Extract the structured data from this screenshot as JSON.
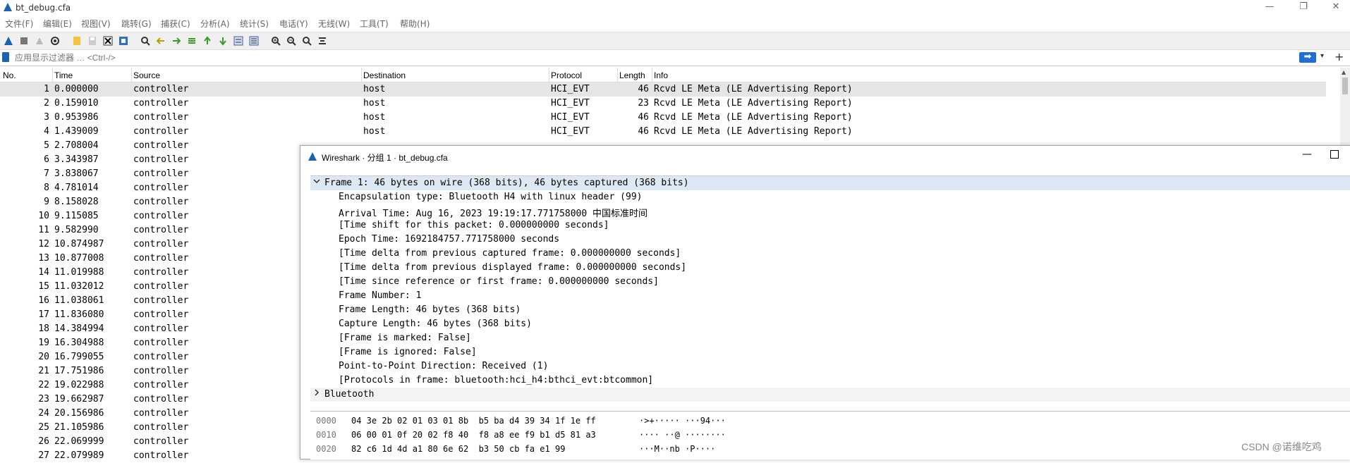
{
  "window": {
    "title": "bt_debug.cfa",
    "minimize_glyph": "—",
    "restore_glyph": "❐",
    "close_glyph": "✕"
  },
  "menu": [
    "文件(F)",
    "编辑(E)",
    "视图(V)",
    "跳转(G)",
    "捕获(C)",
    "分析(A)",
    "统计(S)",
    "电话(Y)",
    "无线(W)",
    "工具(T)",
    "帮助(H)"
  ],
  "toolbar_icons": [
    "shark-fin-start-icon",
    "stop-icon",
    "restart-icon",
    "capture-options-icon",
    "open-file-icon",
    "save-icon",
    "close-file-icon",
    "reload-icon",
    "find-icon",
    "go-back-icon",
    "go-forward-icon",
    "go-to-packet-icon",
    "go-first-icon",
    "go-last-icon",
    "autoscroll-icon",
    "colorize-icon",
    "zoom-in-icon",
    "zoom-out-icon",
    "zoom-normal-icon",
    "resize-columns-icon"
  ],
  "filter": {
    "placeholder": "应用显示过滤器 … <Ctrl-/>",
    "apply_glyph": "➡",
    "dropdown_glyph": "▾",
    "plus_glyph": "+"
  },
  "columns": [
    "No.",
    "Time",
    "Source",
    "Destination",
    "Protocol",
    "Length",
    "Info"
  ],
  "packets": [
    {
      "no": "1",
      "time": "0.000000",
      "src": "controller",
      "dst": "host",
      "proto": "HCI_EVT",
      "len": "46",
      "info": "Rcvd LE Meta (LE Advertising Report)"
    },
    {
      "no": "2",
      "time": "0.159010",
      "src": "controller",
      "dst": "host",
      "proto": "HCI_EVT",
      "len": "23",
      "info": "Rcvd LE Meta (LE Advertising Report)"
    },
    {
      "no": "3",
      "time": "0.953986",
      "src": "controller",
      "dst": "host",
      "proto": "HCI_EVT",
      "len": "46",
      "info": "Rcvd LE Meta (LE Advertising Report)"
    },
    {
      "no": "4",
      "time": "1.439009",
      "src": "controller",
      "dst": "host",
      "proto": "HCI_EVT",
      "len": "46",
      "info": "Rcvd LE Meta (LE Advertising Report)"
    },
    {
      "no": "5",
      "time": "2.708004",
      "src": "controller",
      "dst": "",
      "proto": "",
      "len": "",
      "info": ""
    },
    {
      "no": "6",
      "time": "3.343987",
      "src": "controller",
      "dst": "",
      "proto": "",
      "len": "",
      "info": ""
    },
    {
      "no": "7",
      "time": "3.838067",
      "src": "controller",
      "dst": "",
      "proto": "",
      "len": "",
      "info": ""
    },
    {
      "no": "8",
      "time": "4.781014",
      "src": "controller",
      "dst": "",
      "proto": "",
      "len": "",
      "info": ""
    },
    {
      "no": "9",
      "time": "8.158028",
      "src": "controller",
      "dst": "",
      "proto": "",
      "len": "",
      "info": ""
    },
    {
      "no": "10",
      "time": "9.115085",
      "src": "controller",
      "dst": "",
      "proto": "",
      "len": "",
      "info": ""
    },
    {
      "no": "11",
      "time": "9.582990",
      "src": "controller",
      "dst": "",
      "proto": "",
      "len": "",
      "info": ""
    },
    {
      "no": "12",
      "time": "10.874987",
      "src": "controller",
      "dst": "",
      "proto": "",
      "len": "",
      "info": ""
    },
    {
      "no": "13",
      "time": "10.877008",
      "src": "controller",
      "dst": "",
      "proto": "",
      "len": "",
      "info": ""
    },
    {
      "no": "14",
      "time": "11.019988",
      "src": "controller",
      "dst": "",
      "proto": "",
      "len": "",
      "info": ""
    },
    {
      "no": "15",
      "time": "11.032012",
      "src": "controller",
      "dst": "",
      "proto": "",
      "len": "",
      "info": ""
    },
    {
      "no": "16",
      "time": "11.038061",
      "src": "controller",
      "dst": "",
      "proto": "",
      "len": "",
      "info": ""
    },
    {
      "no": "17",
      "time": "11.836080",
      "src": "controller",
      "dst": "",
      "proto": "",
      "len": "",
      "info": ""
    },
    {
      "no": "18",
      "time": "14.384994",
      "src": "controller",
      "dst": "",
      "proto": "",
      "len": "",
      "info": ""
    },
    {
      "no": "19",
      "time": "16.304988",
      "src": "controller",
      "dst": "",
      "proto": "",
      "len": "",
      "info": ""
    },
    {
      "no": "20",
      "time": "16.799055",
      "src": "controller",
      "dst": "",
      "proto": "",
      "len": "",
      "info": ""
    },
    {
      "no": "21",
      "time": "17.751986",
      "src": "controller",
      "dst": "",
      "proto": "",
      "len": "",
      "info": ""
    },
    {
      "no": "22",
      "time": "19.022988",
      "src": "controller",
      "dst": "",
      "proto": "",
      "len": "",
      "info": ""
    },
    {
      "no": "23",
      "time": "19.662987",
      "src": "controller",
      "dst": "",
      "proto": "",
      "len": "",
      "info": ""
    },
    {
      "no": "24",
      "time": "20.156986",
      "src": "controller",
      "dst": "",
      "proto": "",
      "len": "",
      "info": ""
    },
    {
      "no": "25",
      "time": "21.105986",
      "src": "controller",
      "dst": "",
      "proto": "",
      "len": "",
      "info": ""
    },
    {
      "no": "26",
      "time": "22.069999",
      "src": "controller",
      "dst": "",
      "proto": "",
      "len": "",
      "info": ""
    },
    {
      "no": "27",
      "time": "22.079989",
      "src": "controller",
      "dst": "",
      "proto": "",
      "len": "",
      "info": ""
    }
  ],
  "dialog": {
    "title": "Wireshark · 分组 1 · bt_debug.cfa",
    "tree": [
      {
        "text": "Frame 1: 46 bytes on wire (368 bits), 46 bytes captured (368 bits)",
        "toggle": "v",
        "level": 0
      },
      {
        "text": "Encapsulation type: Bluetooth H4 with linux header (99)",
        "toggle": "",
        "level": 1
      },
      {
        "text": "Arrival Time: Aug 16, 2023 19:19:17.771758000 中国标准时间",
        "toggle": "",
        "level": 1
      },
      {
        "text": "[Time shift for this packet: 0.000000000 seconds]",
        "toggle": "",
        "level": 1
      },
      {
        "text": "Epoch Time: 1692184757.771758000 seconds",
        "toggle": "",
        "level": 1
      },
      {
        "text": "[Time delta from previous captured frame: 0.000000000 seconds]",
        "toggle": "",
        "level": 1
      },
      {
        "text": "[Time delta from previous displayed frame: 0.000000000 seconds]",
        "toggle": "",
        "level": 1
      },
      {
        "text": "[Time since reference or first frame: 0.000000000 seconds]",
        "toggle": "",
        "level": 1
      },
      {
        "text": "Frame Number: 1",
        "toggle": "",
        "level": 1
      },
      {
        "text": "Frame Length: 46 bytes (368 bits)",
        "toggle": "",
        "level": 1
      },
      {
        "text": "Capture Length: 46 bytes (368 bits)",
        "toggle": "",
        "level": 1
      },
      {
        "text": "[Frame is marked: False]",
        "toggle": "",
        "level": 1
      },
      {
        "text": "[Frame is ignored: False]",
        "toggle": "",
        "level": 1
      },
      {
        "text": "Point-to-Point Direction: Received (1)",
        "toggle": "",
        "level": 1
      },
      {
        "text": "[Protocols in frame: bluetooth:hci_h4:bthci_evt:btcommon]",
        "toggle": "",
        "level": 1
      },
      {
        "text": "Bluetooth",
        "toggle": ">",
        "level": 0
      }
    ],
    "hex": [
      {
        "offset": "0000",
        "bytes": "04 3e 2b 02 01 03 01 8b  b5 ba d4 39 34 1f 1e ff",
        "ascii": "·>+····· ···94···"
      },
      {
        "offset": "0010",
        "bytes": "06 00 01 0f 20 02 f8 40  f8 a8 ee f9 b1 d5 81 a3",
        "ascii": "···· ··@ ········"
      },
      {
        "offset": "0020",
        "bytes": "82 c6 1d 4d a1 80 6e 62  b3 50 cb fa e1 99",
        "ascii": "···M··nb ·P····"
      }
    ]
  },
  "watermark": "CSDN @诺维吃鸡"
}
